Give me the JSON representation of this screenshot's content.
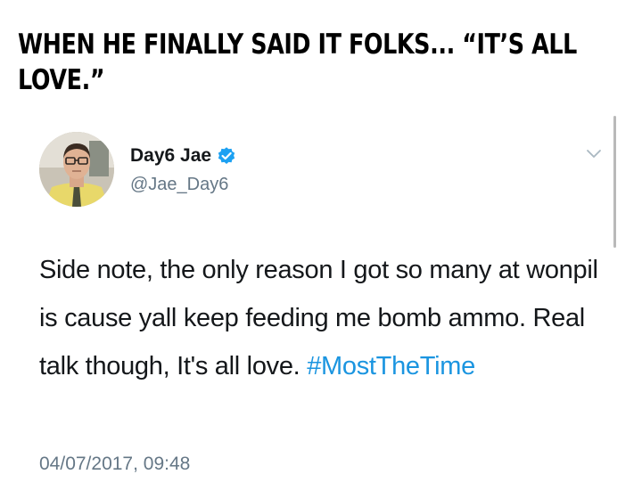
{
  "meme": {
    "caption": "WHEN HE FINALLY SAID IT FOLKS... “IT’S ALL LOVE.”"
  },
  "tweet": {
    "display_name": "Day6 Jae",
    "handle": "@Jae_Day6",
    "verified": true,
    "text": "Side note, the only reason I got so many at wonpil is cause yall keep feeding me bomb ammo. Real talk though, It's all love.",
    "hashtag": "#MostTheTime",
    "timestamp": "04/07/2017, 09:48",
    "avatar_icon": "profile-photo-man-in-glasses-and-tie",
    "menu_icon": "chevron-down-icon"
  },
  "colors": {
    "link": "#1b95e0",
    "secondary_text": "#657786",
    "primary_text": "#14171a",
    "verified_badge": "#1da1f2"
  }
}
